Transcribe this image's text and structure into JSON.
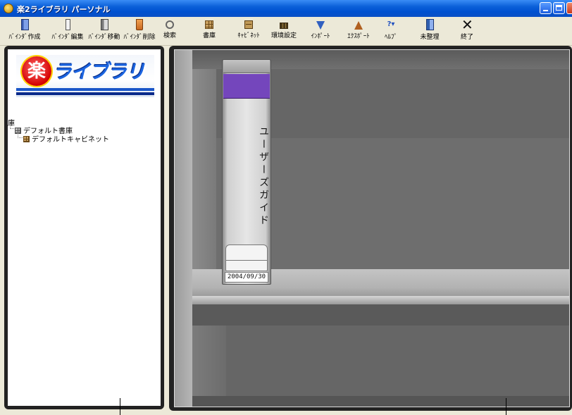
{
  "window": {
    "title": "楽2ライブラリ パーソナル"
  },
  "toolbar": {
    "buttons": [
      {
        "id": "binder-create",
        "label": "ﾊﾞｲﾝﾀﾞ作成",
        "icon": "binder-new-icon"
      },
      {
        "id": "binder-edit",
        "label": "ﾊﾞｲﾝﾀﾞ編集",
        "icon": "binder-edit-icon"
      },
      {
        "id": "binder-move",
        "label": "ﾊﾞｲﾝﾀﾞ移動",
        "icon": "binder-move-icon"
      },
      {
        "id": "binder-delete",
        "label": "ﾊﾞｲﾝﾀﾞ削除",
        "icon": "trash-icon"
      },
      {
        "id": "search",
        "label": "検索",
        "icon": "search-icon"
      },
      {
        "id": "library",
        "label": "書庫",
        "icon": "bookcase-icon"
      },
      {
        "id": "cabinet",
        "label": "ｷｬﾋﾞﾈｯﾄ",
        "icon": "cabinet-icon"
      },
      {
        "id": "settings",
        "label": "環境設定",
        "icon": "settings-icon"
      },
      {
        "id": "import",
        "label": "ｲﾝﾎﾟｰﾄ",
        "icon": "import-icon"
      },
      {
        "id": "export",
        "label": "ｴｸｽﾎﾟｰﾄ",
        "icon": "export-icon"
      },
      {
        "id": "help",
        "label": "ﾍﾙﾌﾟ",
        "icon": "help-icon",
        "glyph": "?▾"
      },
      {
        "id": "unsorted",
        "label": "未整理",
        "icon": "unsorted-icon"
      },
      {
        "id": "exit",
        "label": "終了",
        "icon": "close-icon",
        "glyph": "✕"
      }
    ]
  },
  "sidebar": {
    "logo": {
      "kanji": "楽",
      "text": "ライブラリ"
    },
    "tree": {
      "root": "庫",
      "library": "デフォルト書庫",
      "cabinet": "デフォルトキャビネット"
    }
  },
  "shelf": {
    "binder": {
      "title": "ユーザーズガイド",
      "date": "2004/09/30",
      "band_color": "#7446bc"
    }
  },
  "colors": {
    "titlebar": "#0a5fd8",
    "frame": "#222222",
    "accent": "#1a56c8"
  }
}
